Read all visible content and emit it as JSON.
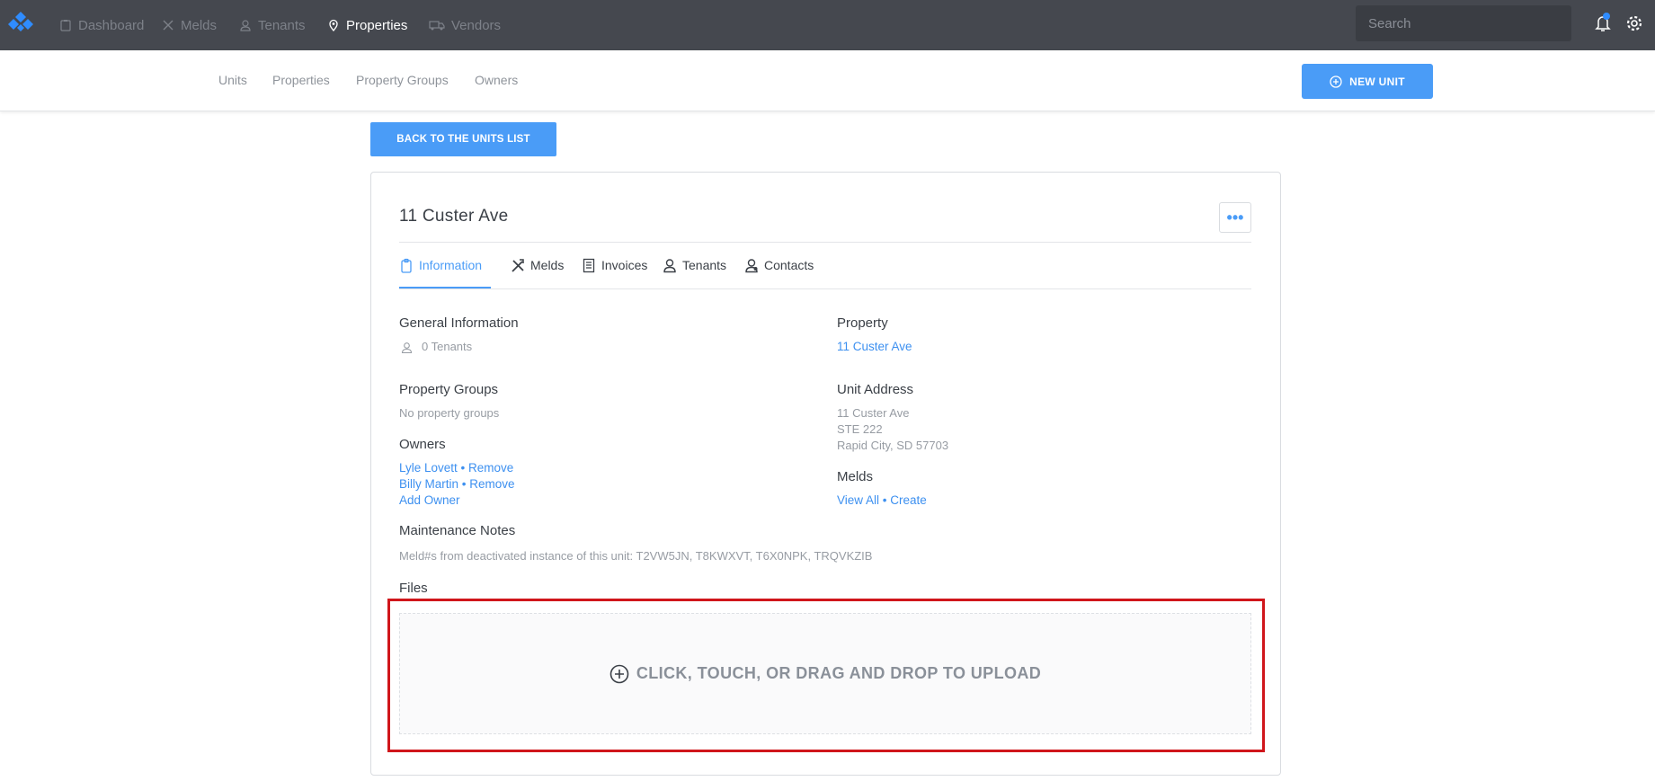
{
  "topnav": {
    "items": [
      {
        "label": "Dashboard",
        "icon": "clipboard-icon"
      },
      {
        "label": "Melds",
        "icon": "tools-icon"
      },
      {
        "label": "Tenants",
        "icon": "person-icon"
      },
      {
        "label": "Properties",
        "icon": "location-pin-icon"
      },
      {
        "label": "Vendors",
        "icon": "truck-icon"
      }
    ],
    "search_placeholder": "Search"
  },
  "subnav": {
    "items": [
      "Units",
      "Properties",
      "Property Groups",
      "Owners"
    ],
    "new_unit_label": "NEW UNIT"
  },
  "back_button": "BACK TO THE UNITS LIST",
  "unit": {
    "title": "11 Custer Ave",
    "more_label": "•••",
    "tabs": [
      {
        "label": "Information",
        "icon": "clipboard-icon"
      },
      {
        "label": "Melds",
        "icon": "tools-icon"
      },
      {
        "label": "Invoices",
        "icon": "document-icon"
      },
      {
        "label": "Tenants",
        "icon": "person-icon"
      },
      {
        "label": "Contacts",
        "icon": "contacts-icon"
      }
    ]
  },
  "info": {
    "general_heading": "General Information",
    "tenants_count": "0 Tenants",
    "property_groups_heading": "Property Groups",
    "property_groups_value": "No property groups",
    "owners_heading": "Owners",
    "owners": [
      {
        "name": "Lyle Lovett",
        "sep": " • ",
        "remove": "Remove"
      },
      {
        "name": "Billy Martin",
        "sep": " • ",
        "remove": "Remove"
      }
    ],
    "add_owner": "Add Owner",
    "maintenance_heading": "Maintenance Notes",
    "maintenance_text": "Meld#s from deactivated instance of this unit: T2VW5JN, T8KWXVT, T6X0NPK, TRQVKZIB",
    "files_heading": "Files",
    "property_heading": "Property",
    "property_link": "11 Custer Ave",
    "unit_address_heading": "Unit Address",
    "address_lines": [
      "11 Custer Ave",
      "STE 222",
      "Rapid City, SD 57703"
    ],
    "melds_heading": "Melds",
    "melds_view_all": "View All",
    "melds_sep": " • ",
    "melds_create": "Create"
  },
  "upload": {
    "label": "CLICK, TOUCH, OR DRAG AND DROP TO UPLOAD"
  },
  "colors": {
    "nav_bg": "#45484f",
    "accent": "#4a9cf7",
    "highlight": "#d0161b"
  }
}
